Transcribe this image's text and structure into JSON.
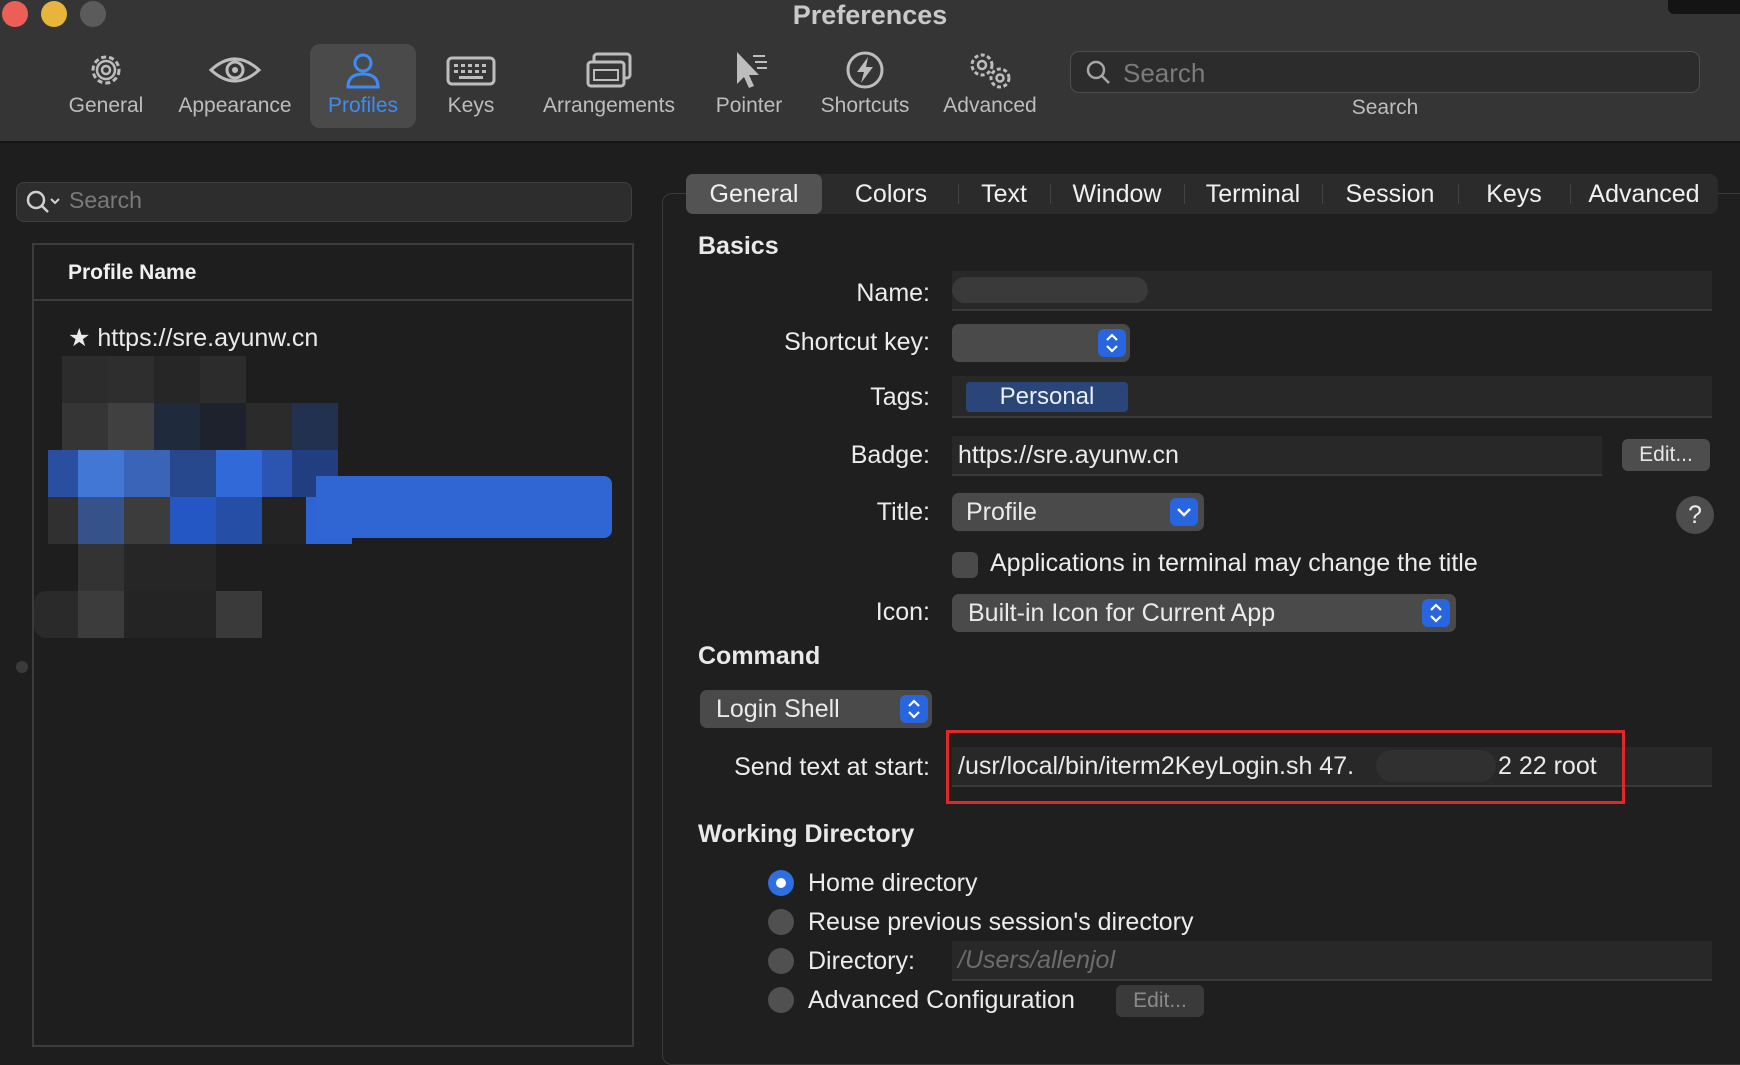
{
  "window": {
    "title": "Preferences"
  },
  "toolbar": {
    "items": [
      {
        "label": "General",
        "icon": "gear-icon"
      },
      {
        "label": "Appearance",
        "icon": "eye-icon"
      },
      {
        "label": "Profiles",
        "icon": "person-icon",
        "selected": true
      },
      {
        "label": "Keys",
        "icon": "keyboard-icon"
      },
      {
        "label": "Arrangements",
        "icon": "windows-icon"
      },
      {
        "label": "Pointer",
        "icon": "pointer-icon"
      },
      {
        "label": "Shortcuts",
        "icon": "lightning-icon"
      },
      {
        "label": "Advanced",
        "icon": "gears-icon"
      }
    ],
    "search": {
      "placeholder": "Search",
      "caption": "Search"
    }
  },
  "profiles_list": {
    "search_placeholder": "Search",
    "column_header": "Profile Name",
    "rows": [
      {
        "label": "https://sre.ayunw.cn",
        "default": true
      }
    ]
  },
  "tabs": [
    "General",
    "Colors",
    "Text",
    "Window",
    "Terminal",
    "Session",
    "Keys",
    "Advanced"
  ],
  "basics": {
    "heading": "Basics",
    "name_label": "Name:",
    "shortcut_label": "Shortcut key:",
    "tags_label": "Tags:",
    "tag": "Personal",
    "badge_label": "Badge:",
    "badge_value": "https://sre.ayunw.cn",
    "badge_edit": "Edit...",
    "title_label": "Title:",
    "title_value": "Profile",
    "help": "?",
    "title_checkbox": "Applications in terminal may change the title",
    "icon_label": "Icon:",
    "icon_value": "Built-in Icon for Current App"
  },
  "command": {
    "heading": "Command",
    "shell_value": "Login Shell",
    "send_label": "Send text at start:",
    "send_prefix": "/usr/local/bin/iterm2KeyLogin.sh 47.",
    "send_suffix": "2 22 root"
  },
  "working_directory": {
    "heading": "Working Directory",
    "options": [
      "Home directory",
      "Reuse previous session's directory",
      "Directory:",
      "Advanced Configuration"
    ],
    "selected": "Home directory",
    "directory_placeholder": "/Users/allenjol",
    "edit_button": "Edit..."
  },
  "colors": {
    "accent": "#2f6ee0",
    "highlight": "#e0282b",
    "selected_toolbar": "#3d8cf5"
  }
}
